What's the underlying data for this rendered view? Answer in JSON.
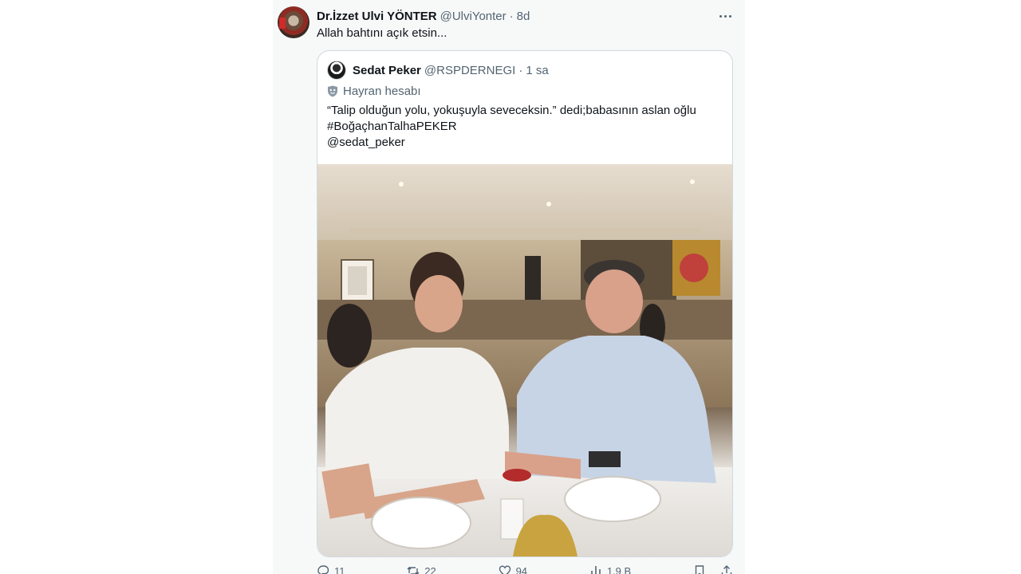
{
  "post": {
    "author_name": "Dr.İzzet Ulvi YÖNTER",
    "author_handle": "@UlviYonter",
    "separator": "·",
    "time": "8d",
    "text": "Allah bahtını açık etsin..."
  },
  "quoted": {
    "author_name": "Sedat Peker",
    "author_handle": "@RSPDERNEGI",
    "separator": "·",
    "time": "1 sa",
    "label": "Hayran hesabı",
    "lines": [
      "“Talip olduğun yolu, yokuşuyla seveceksin.” dedi;babasının aslan oğlu",
      "#BoğaçhanTalhaPEKER",
      "@sedat_peker"
    ]
  },
  "actions": {
    "reply_count": "11",
    "repost_count": "22",
    "like_count": "94",
    "views_count": "1,9 B"
  },
  "icons": {
    "more": "more-horizontal-icon",
    "label": "mask-shield-icon",
    "reply": "reply-icon",
    "repost": "repost-icon",
    "like": "heart-icon",
    "views": "views-chart-icon",
    "bookmark": "bookmark-icon",
    "share": "share-icon"
  },
  "colors": {
    "text_primary": "#0f1419",
    "text_secondary": "#536471",
    "border": "#cfd9de",
    "column_bg": "#f7f9f9"
  }
}
